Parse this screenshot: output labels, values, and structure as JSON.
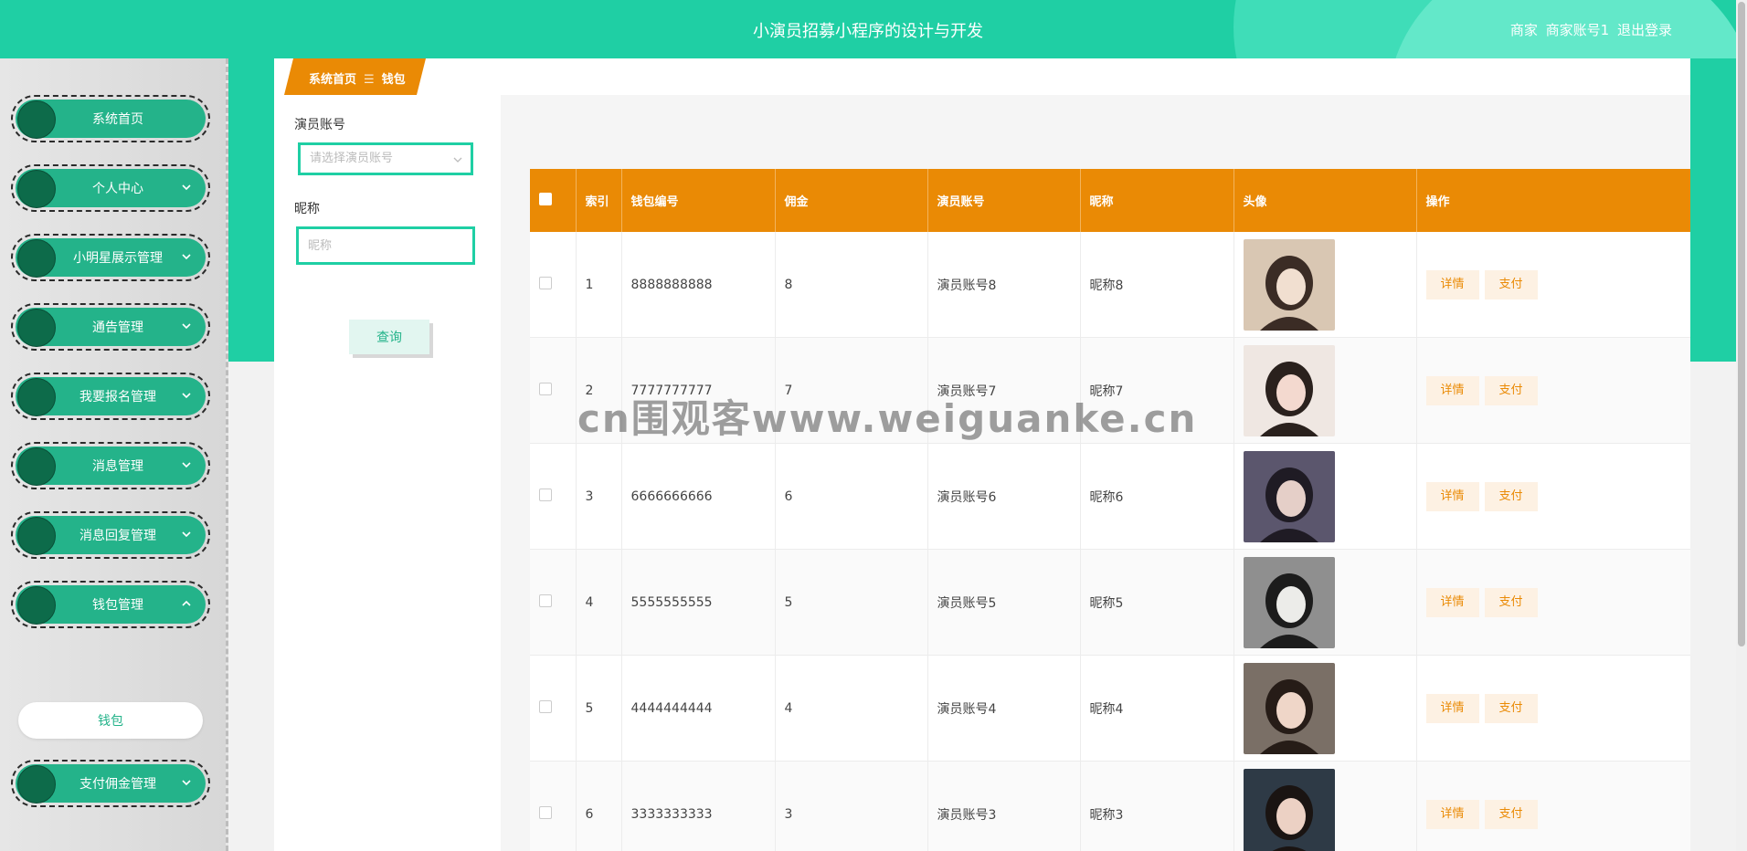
{
  "header": {
    "title": "小演员招募小程序的设计与开发",
    "role": "商家",
    "username": "商家账号1",
    "logout": "退出登录"
  },
  "sidebar": {
    "items": [
      {
        "label": "系统首页",
        "has_arrow": false
      },
      {
        "label": "个人中心",
        "has_arrow": true
      },
      {
        "label": "小明星展示管理",
        "has_arrow": true
      },
      {
        "label": "通告管理",
        "has_arrow": true
      },
      {
        "label": "我要报名管理",
        "has_arrow": true
      },
      {
        "label": "消息管理",
        "has_arrow": true
      },
      {
        "label": "消息回复管理",
        "has_arrow": true
      },
      {
        "label": "钱包管理",
        "has_arrow": true,
        "expanded": true
      },
      {
        "label": "支付佣金管理",
        "has_arrow": true
      }
    ],
    "sub_item": "钱包"
  },
  "breadcrumb": {
    "home": "系统首页",
    "separator": "☰",
    "current": "钱包"
  },
  "filter": {
    "account_label": "演员账号",
    "account_placeholder": "请选择演员账号",
    "nickname_label": "昵称",
    "nickname_placeholder": "昵称",
    "query_button": "查询"
  },
  "table": {
    "columns": [
      "",
      "索引",
      "钱包编号",
      "佣金",
      "演员账号",
      "昵称",
      "头像",
      "操作"
    ],
    "rows": [
      {
        "index": "1",
        "wallet_no": "8888888888",
        "commission": "8",
        "account": "演员账号8",
        "nickname": "昵称8"
      },
      {
        "index": "2",
        "wallet_no": "7777777777",
        "commission": "7",
        "account": "演员账号7",
        "nickname": "昵称7"
      },
      {
        "index": "3",
        "wallet_no": "6666666666",
        "commission": "6",
        "account": "演员账号6",
        "nickname": "昵称6"
      },
      {
        "index": "4",
        "wallet_no": "5555555555",
        "commission": "5",
        "account": "演员账号5",
        "nickname": "昵称5"
      },
      {
        "index": "5",
        "wallet_no": "4444444444",
        "commission": "4",
        "account": "演员账号4",
        "nickname": "昵称4"
      },
      {
        "index": "6",
        "wallet_no": "3333333333",
        "commission": "3",
        "account": "演员账号3",
        "nickname": "昵称3"
      }
    ],
    "detail_label": "详情",
    "pay_label": "支付"
  },
  "watermark": "cn围观客www.weiguanke.cn",
  "colors": {
    "brand": "#1fcfa4",
    "accent": "#ea8a05",
    "menu": "#24b38a"
  }
}
